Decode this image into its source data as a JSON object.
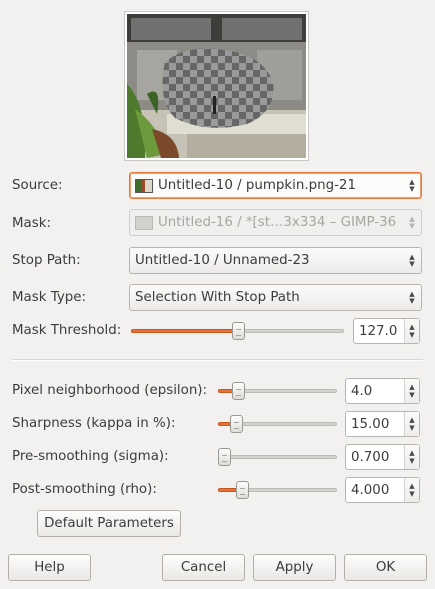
{
  "preview": {
    "image_icon": "pumpkin-image-preview"
  },
  "source": {
    "label": "Source:",
    "value": "Untitled-10 / pumpkin.png-21"
  },
  "mask": {
    "label": "Mask:",
    "value": "Untitled-16 / *[st…3x334 – GIMP-36"
  },
  "stop_path": {
    "label": "Stop Path:",
    "value": "Untitled-10 / Unnamed-23"
  },
  "mask_type": {
    "label": "Mask Type:",
    "value": "Selection With Stop Path"
  },
  "mask_threshold": {
    "label": "Mask Threshold:",
    "value": "127.0",
    "fraction": 0.5
  },
  "pixel_neighborhood": {
    "label": "Pixel neighborhood (epsilon):",
    "value": "4.0",
    "fraction": 0.17
  },
  "sharpness": {
    "label": "Sharpness (kappa in %):",
    "value": "15.00",
    "fraction": 0.15
  },
  "pre_smoothing": {
    "label": "Pre-smoothing (sigma):",
    "value": "0.700",
    "fraction": 0.05
  },
  "post_smoothing": {
    "label": "Post-smoothing (rho):",
    "value": "4.000",
    "fraction": 0.2
  },
  "buttons": {
    "default_parameters": "Default Parameters",
    "help": "Help",
    "cancel": "Cancel",
    "apply": "Apply",
    "ok": "OK"
  },
  "colors": {
    "accent": "#e8703a",
    "background": "#f2f1f0"
  }
}
